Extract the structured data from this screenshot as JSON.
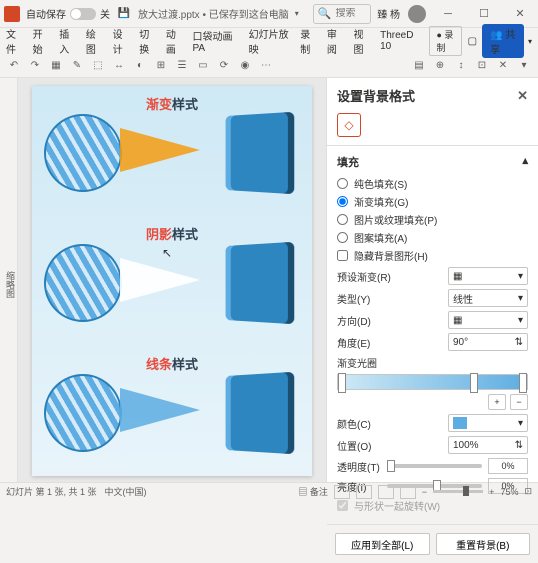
{
  "titlebar": {
    "autosave": "自动保存",
    "autosave_state": "关",
    "filename": "放大过渡.pptx • 已保存到这台电脑",
    "search_placeholder": "搜索",
    "username": "臻 杨"
  },
  "ribbon": {
    "tabs": [
      "文件",
      "开始",
      "插入",
      "绘图",
      "设计",
      "切换",
      "动画",
      "口袋动画 PA",
      "幻灯片放映",
      "录制",
      "审阅",
      "视图",
      "ThreeD 10"
    ],
    "record": "录制",
    "share": "共享"
  },
  "tab_strip": "缩略图",
  "slide": {
    "t1a": "渐变",
    "t1b": "样式",
    "t2a": "阴影",
    "t2b": "样式",
    "t3a": "线条",
    "t3b": "样式"
  },
  "pane": {
    "title": "设置背景格式",
    "fill_section": "填充",
    "fills": {
      "solid": "纯色填充(S)",
      "gradient": "渐变填充(G)",
      "picture": "图片或纹理填充(P)",
      "pattern": "图案填充(A)",
      "hide": "隐藏背景图形(H)"
    },
    "preset": "预设渐变(R)",
    "type": "类型(Y)",
    "type_val": "线性",
    "direction": "方向(D)",
    "angle": "角度(E)",
    "angle_val": "90°",
    "stops": "渐变光圈",
    "color": "颜色(C)",
    "position": "位置(O)",
    "position_val": "100%",
    "transparency": "透明度(T)",
    "transparency_val": "0%",
    "brightness": "亮度(I)",
    "brightness_val": "0%",
    "rotate": "与形状一起旋转(W)",
    "apply_all": "应用到全部(L)",
    "reset": "重置背景(B)"
  },
  "status": {
    "slide_info": "幻灯片 第 1 张, 共 1 张",
    "lang": "中文(中国)",
    "notes": "备注",
    "zoom": "75%"
  }
}
